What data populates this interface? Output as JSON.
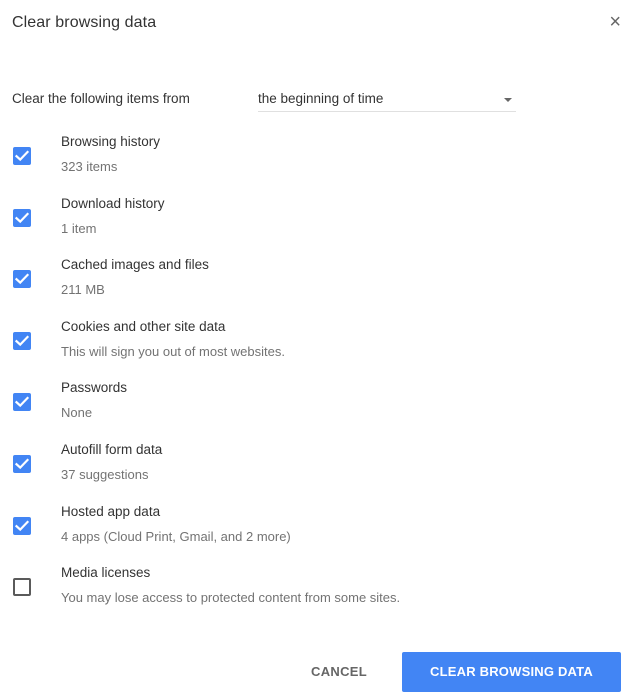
{
  "dialog": {
    "title": "Clear browsing data",
    "close_glyph": "×"
  },
  "time_range": {
    "label": "Clear the following items from",
    "selected": "the beginning of time"
  },
  "items": [
    {
      "label": "Browsing history",
      "description": "323 items",
      "checked": true
    },
    {
      "label": "Download history",
      "description": "1 item",
      "checked": true
    },
    {
      "label": "Cached images and files",
      "description": "211 MB",
      "checked": true
    },
    {
      "label": "Cookies and other site data",
      "description": "This will sign you out of most websites.",
      "checked": true
    },
    {
      "label": "Passwords",
      "description": "None",
      "checked": true
    },
    {
      "label": "Autofill form data",
      "description": "37 suggestions",
      "checked": true
    },
    {
      "label": "Hosted app data",
      "description": "4 apps (Cloud Print, Gmail, and 2 more)",
      "checked": true
    },
    {
      "label": "Media licenses",
      "description": "You may lose access to protected content from some sites.",
      "checked": false
    }
  ],
  "buttons": {
    "cancel": "CANCEL",
    "clear": "CLEAR BROWSING DATA"
  },
  "colors": {
    "accent": "#4285f4",
    "text": "#333333",
    "secondary_text": "#737373"
  }
}
